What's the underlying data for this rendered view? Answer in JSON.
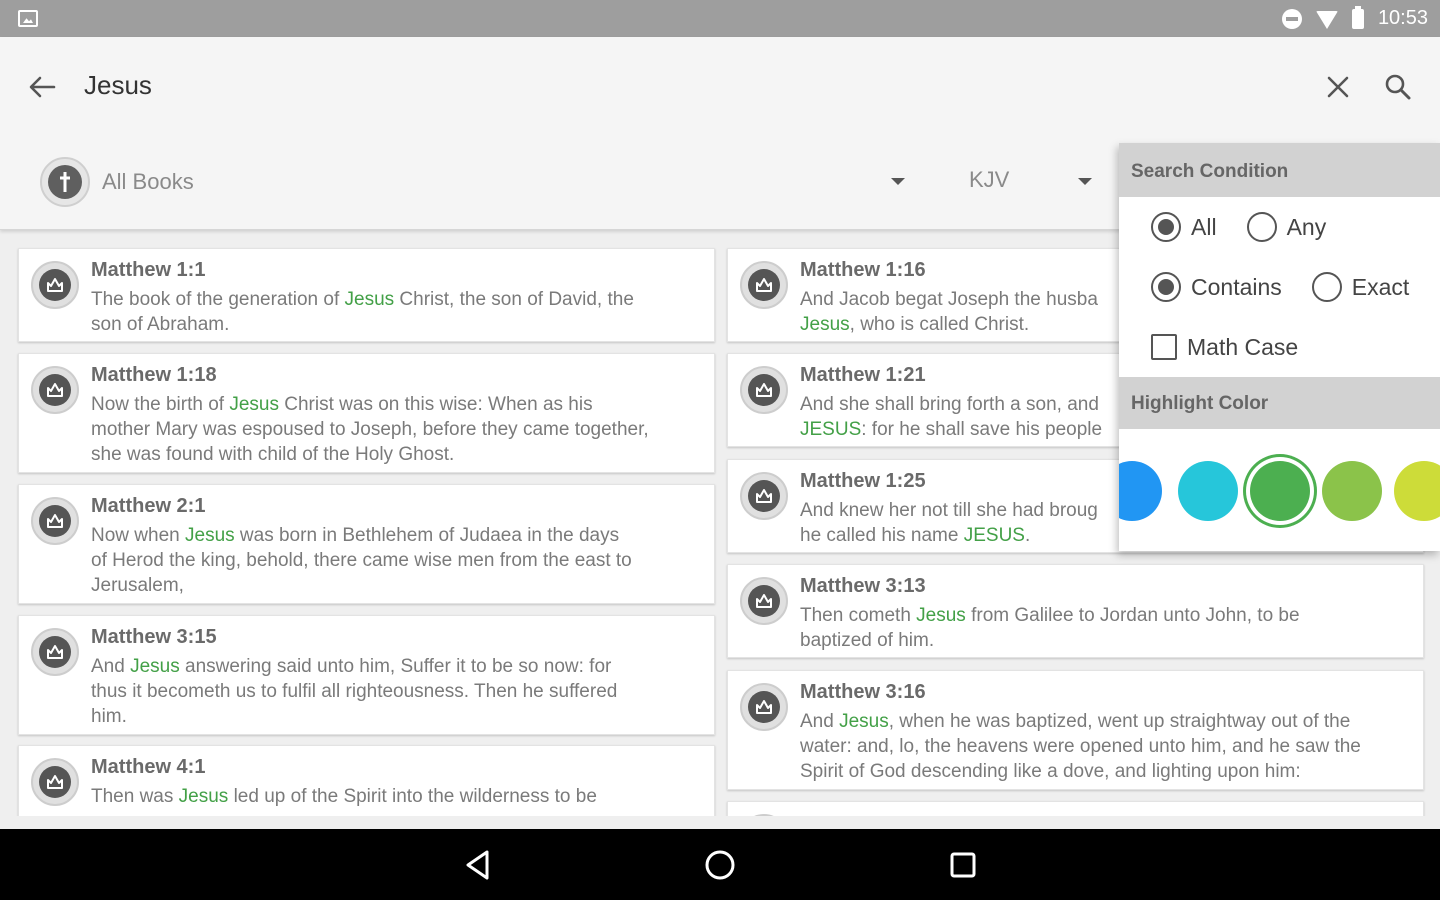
{
  "status_bar": {
    "time": "10:53"
  },
  "search": {
    "query": "Jesus"
  },
  "filters": {
    "book": "All Books",
    "version": "KJV"
  },
  "popup": {
    "condition_title": "Search Condition",
    "match_all": "All",
    "match_any": "Any",
    "mode_contains": "Contains",
    "mode_exact": "Exact",
    "match_case": "Math Case",
    "highlight_title": "Highlight Color",
    "colors": [
      "#2196f3",
      "#26c6da",
      "#4caf50",
      "#8bc34a",
      "#cddc39"
    ],
    "selected_color": "#4caf50"
  },
  "results": [
    {
      "ref": "Matthew 1:1",
      "lines": [
        [
          "The book of the generation of ",
          "Jesus",
          " Christ, the son of David, the"
        ],
        [
          "son of Abraham."
        ]
      ]
    },
    {
      "ref": "Matthew 1:16",
      "lines": [
        [
          "And Jacob begat Joseph the husba"
        ],
        [
          "",
          "Jesus",
          ", who is called Christ."
        ]
      ]
    },
    {
      "ref": "Matthew 1:18",
      "lines": [
        [
          "Now the birth of ",
          "Jesus",
          " Christ was on this wise: When as his"
        ],
        [
          "mother Mary was espoused to Joseph, before they came together,"
        ],
        [
          "she was found with child of the Holy Ghost."
        ]
      ]
    },
    {
      "ref": "Matthew 1:21",
      "lines": [
        [
          "And she shall bring forth a son, and"
        ],
        [
          "",
          "JESUS",
          ": for he shall save his people"
        ]
      ]
    },
    {
      "ref": "Matthew 1:25",
      "lines": [
        [
          "And knew her not till she had broug"
        ],
        [
          "he called his name ",
          "JESUS",
          "."
        ]
      ]
    },
    {
      "ref": "Matthew 2:1",
      "lines": [
        [
          "Now when ",
          "Jesus",
          " was born in Bethlehem of Judaea in the days"
        ],
        [
          "of Herod the king, behold, there came wise men from the east to"
        ],
        [
          "Jerusalem,"
        ]
      ]
    },
    {
      "ref": "Matthew 3:13",
      "lines": [
        [
          "Then cometh ",
          "Jesus",
          " from Galilee to Jordan unto John, to be"
        ],
        [
          "baptized of him."
        ]
      ]
    },
    {
      "ref": "Matthew 3:15",
      "lines": [
        [
          "And ",
          "Jesus",
          " answering said unto him, Suffer it to be so now: for"
        ],
        [
          "thus it becometh us to fulfil all righteousness. Then he suffered"
        ],
        [
          "him."
        ]
      ]
    },
    {
      "ref": "Matthew 3:16",
      "lines": [
        [
          "And ",
          "Jesus",
          ", when he was baptized, went up straightway out of the"
        ],
        [
          "water: and, lo, the heavens were opened unto him, and he saw the"
        ],
        [
          "Spirit of God descending like a dove, and lighting upon him:"
        ]
      ]
    },
    {
      "ref": "Matthew 4:1",
      "lines": [
        [
          "Then was ",
          "Jesus",
          " led up of the Spirit into the wilderness to be"
        ]
      ]
    },
    {
      "ref": "",
      "lines": []
    }
  ]
}
